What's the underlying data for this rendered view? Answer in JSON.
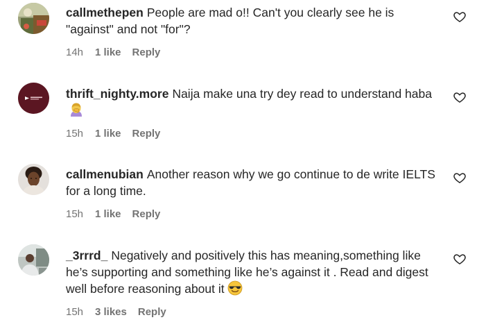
{
  "comments": [
    {
      "username": "callmethepen",
      "text": "People are mad o!! Can't you clearly see he is \"against\" and not \"for\"?",
      "time": "14h",
      "likes": "1 like",
      "reply": "Reply",
      "avatar_icon": "profile-photo"
    },
    {
      "username": "thrift_nighty.more",
      "text": "Naija make una try dey read to understand haba",
      "emoji": "person-facepalming-emoji",
      "time": "15h",
      "likes": "1 like",
      "reply": "Reply",
      "avatar_icon": "brand-logo-avatar"
    },
    {
      "username": "callmenubian",
      "text": "Another reason why we go continue to de write IELTS for a long time.",
      "time": "15h",
      "likes": "1 like",
      "reply": "Reply",
      "avatar_icon": "profile-photo"
    },
    {
      "username": "_3rrrd_",
      "text": "Negatively and positively this has meaning,something like he’s supporting and something like he’s against it . Read and digest well before reasoning about it",
      "emoji": "smiling-face-with-sunglasses-emoji",
      "time": "15h",
      "likes": "3 likes",
      "reply": "Reply",
      "avatar_icon": "profile-photo"
    }
  ],
  "colors": {
    "text": "#262626",
    "secondary": "#737373",
    "background": "#ffffff"
  }
}
